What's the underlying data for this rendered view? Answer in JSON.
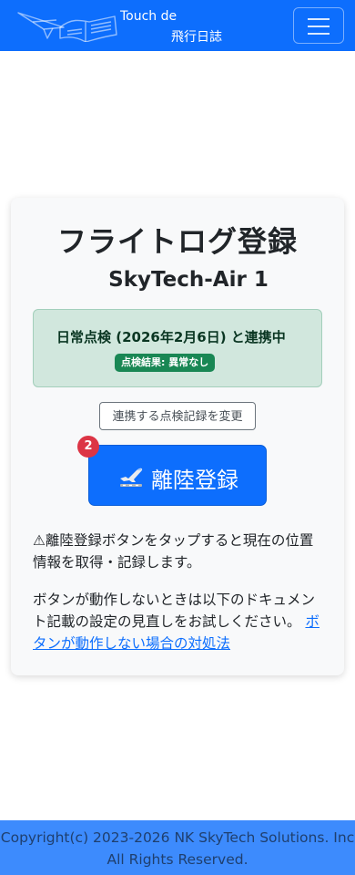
{
  "navbar": {
    "brand_line1": "Touch de",
    "brand_line2": "飛行日誌",
    "logo_icon": "paper-plane-book-icon",
    "menu_icon": "hamburger-icon"
  },
  "card": {
    "title": "フライトログ登録",
    "aircraft": "SkyTech-Air 1",
    "inspection_link": {
      "text": "日常点検 (2026年2月6日) と連携中",
      "result_badge": "点検結果: 異常なし"
    },
    "change_button": "連携する点検記録を変更",
    "takeoff_button": {
      "label": "離陸登録",
      "icon": "takeoff-plane-icon",
      "count": "2"
    },
    "note_location": "⚠離陸登録ボタンをタップすると現在の位置情報を取得・記録します。",
    "note_help": "ボタンが動作しないときは以下のドキュメント記載の設定の見直しをお試しください。",
    "help_link": "ボタンが動作しない場合の対処法"
  },
  "footer": {
    "copyright": "Copyright(c) 2023-2026 NK SkyTech Solutions. Inc All Rights Reserved."
  },
  "colors": {
    "primary": "#0d6efd",
    "success_bg": "#d1e7dd",
    "success_badge": "#198754",
    "danger": "#dc3545",
    "footer_bg": "#3d8bfd"
  }
}
